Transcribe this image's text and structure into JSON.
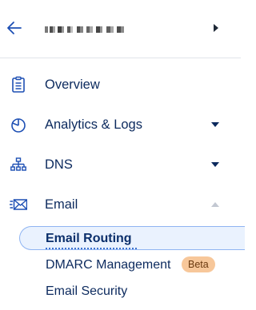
{
  "header": {
    "back_icon": "arrow-left-icon",
    "account_name": "",
    "expand_icon": "chevron-right-icon"
  },
  "nav": {
    "items": [
      {
        "label": "Overview",
        "icon": "clipboard-icon",
        "caret": ""
      },
      {
        "label": "Analytics & Logs",
        "icon": "pie-chart-icon",
        "caret": "caret-down-icon"
      },
      {
        "label": "DNS",
        "icon": "network-tree-icon",
        "caret": "caret-down-icon"
      },
      {
        "label": "Email",
        "icon": "email-icon",
        "caret": "caret-up-icon"
      }
    ],
    "email_subitems": [
      {
        "label": "Email Routing",
        "active": true
      },
      {
        "label": "DMARC Management",
        "badge": "Beta"
      },
      {
        "label": "Email Security"
      }
    ]
  },
  "colors": {
    "text": "#0c2a5e",
    "active_bg": "#eaf2fe",
    "active_border": "#8fb4f2",
    "badge_bg": "#f7c79a"
  }
}
